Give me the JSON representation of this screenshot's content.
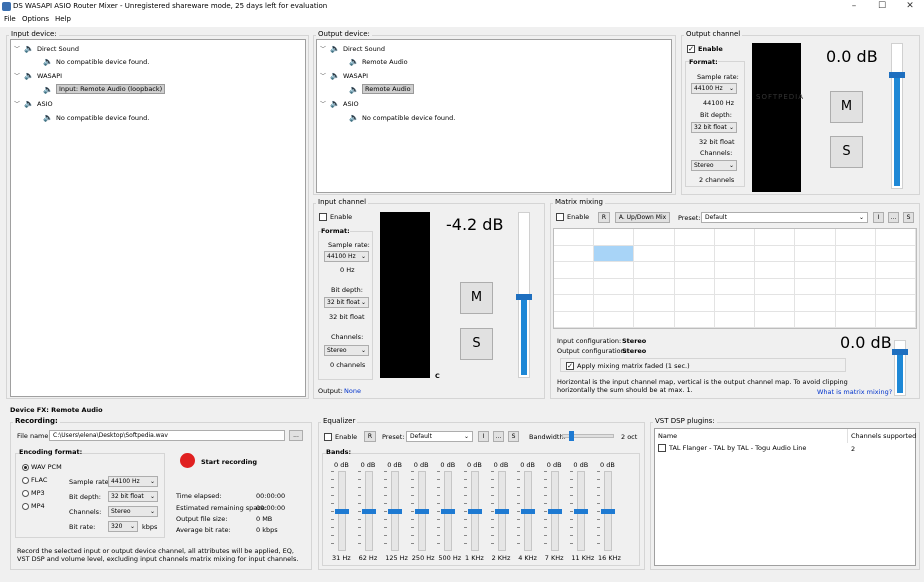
{
  "window": {
    "title": "DS WASAPI ASIO Router Mixer - Unregistered shareware mode, 25 days left for evaluation",
    "minimize": "–",
    "maximize": "☐",
    "close": "✕"
  },
  "menu": [
    "File",
    "Options",
    "Help"
  ],
  "input_device": {
    "label": "Input device:",
    "tree": [
      {
        "text": "Direct Sound",
        "level": 0
      },
      {
        "text": "No compatible device found.",
        "level": 1
      },
      {
        "text": "WASAPI",
        "level": 0
      },
      {
        "text": "Input: Remote Audio (loopback)",
        "level": 1
      },
      {
        "text": "ASIO",
        "level": 0
      },
      {
        "text": "No compatible device found.",
        "level": 1
      }
    ]
  },
  "output_device": {
    "label": "Output device:",
    "tree": [
      {
        "text": "Direct Sound",
        "level": 0
      },
      {
        "text": "Remote Audio",
        "level": 1
      },
      {
        "text": "WASAPI",
        "level": 0
      },
      {
        "text": "Remote Audio",
        "level": 1
      },
      {
        "text": "ASIO",
        "level": 0
      },
      {
        "text": "No compatible device found.",
        "level": 1
      }
    ]
  },
  "output_channel": {
    "label": "Output channel",
    "enable": "Enable",
    "format": "Format:",
    "sample_rate_label": "Sample rate:",
    "sample_rate": "44100 Hz",
    "sample_rate_text": "44100 Hz",
    "bit_depth_label": "Bit depth:",
    "bit_depth": "32 bit float",
    "bit_depth_text": "32 bit float",
    "channels_label": "Channels:",
    "channels": "Stereo",
    "channels_text": "2 channels",
    "db": "0.0 dB",
    "m": "M",
    "s": "S",
    "watermark": "SOFTPEDIA"
  },
  "input_channel": {
    "label": "Input channel",
    "enable": "Enable",
    "format": "Format:",
    "sample_rate_label": "Sample rate:",
    "sample_rate": "44100 Hz",
    "sample_rate_text": "0 Hz",
    "bit_depth_label": "Bit depth:",
    "bit_depth": "32 bit float",
    "bit_depth_text": "32 bit float",
    "channels_label": "Channels:",
    "channels": "Stereo",
    "channels_text": "0 channels",
    "db": "-4.2 dB",
    "m": "M",
    "s": "S",
    "output_label": "Output:",
    "output_value": "None",
    "c_mark": "C"
  },
  "matrix": {
    "label": "Matrix mixing",
    "enable": "Enable",
    "r": "R",
    "updown": "A. Up/Down Mix",
    "preset_label": "Preset:",
    "preset": "Default",
    "i": "I",
    "dots": "...",
    "s": "S",
    "input_config_label": "Input configuration:",
    "input_config": "Stereo",
    "output_config_label": "Output configuration:",
    "output_config": "Stereo",
    "apply_faded": "Apply mixing matrix faded (1 sec.)",
    "db": "0.0 dB",
    "help_text": "Horizontal is the input channel map, vertical is the output channel map. To avoid clipping horizontally the sum should be at max. 1.",
    "help_link": "What is matrix mixing?"
  },
  "device_fx": {
    "label": "Device FX: Remote Audio"
  },
  "recording": {
    "label": "Recording:",
    "file_name_label": "File name:",
    "file_name": "C:\\Users\\elena\\Desktop\\Softpedia.wav",
    "browse": "...",
    "start": "Start recording",
    "encoding_label": "Encoding format:",
    "formats": [
      "WAV PCM",
      "FLAC",
      "MP3",
      "MP4"
    ],
    "sample_rate_label": "Sample rate:",
    "sample_rate": "44100 Hz",
    "bit_depth_label": "Bit depth:",
    "bit_depth": "32 bit float",
    "channels_label": "Channels:",
    "channels": "Stereo",
    "bit_rate_label": "Bit rate:",
    "bit_rate": "320",
    "kbps": "kbps",
    "time_elapsed_label": "Time elapsed:",
    "time_elapsed": "00:00:00",
    "remaining_label": "Estimated remaining space:",
    "remaining": "00:00:00",
    "file_size_label": "Output file size:",
    "file_size": "0 MB",
    "avg_bitrate_label": "Average bit rate:",
    "avg_bitrate": "0 kbps",
    "note": "Record the selected input or output device channel, all attributes will be applied, EQ, VST DSP and volume level, excluding input channels matrix mixing for input channels."
  },
  "equalizer": {
    "label": "Equalizer",
    "enable": "Enable",
    "r": "R",
    "preset_label": "Preset:",
    "preset": "Default",
    "i": "I",
    "dots": "...",
    "s": "S",
    "bandwidth_label": "Bandwidth:",
    "bandwidth": "2 oct",
    "bands_label": "Bands:",
    "bands": [
      {
        "db": "0 dB",
        "freq": "31 Hz"
      },
      {
        "db": "0 dB",
        "freq": "62 Hz"
      },
      {
        "db": "0 dB",
        "freq": "125 Hz"
      },
      {
        "db": "0 dB",
        "freq": "250 Hz"
      },
      {
        "db": "0 dB",
        "freq": "500 Hz"
      },
      {
        "db": "0 dB",
        "freq": "1 KHz"
      },
      {
        "db": "0 dB",
        "freq": "2 KHz"
      },
      {
        "db": "0 dB",
        "freq": "4 KHz"
      },
      {
        "db": "0 dB",
        "freq": "7 KHz"
      },
      {
        "db": "0 dB",
        "freq": "11 KHz"
      },
      {
        "db": "0 dB",
        "freq": "16 KHz"
      }
    ]
  },
  "vst": {
    "label": "VST DSP plugins:",
    "col_name": "Name",
    "col_channels": "Channels supported",
    "rows": [
      {
        "name": "TAL Flanger - TAL by TAL - Togu Audio Line",
        "channels": "2"
      }
    ]
  },
  "colors": {
    "accent": "#1e88d6",
    "record": "#e02020"
  }
}
